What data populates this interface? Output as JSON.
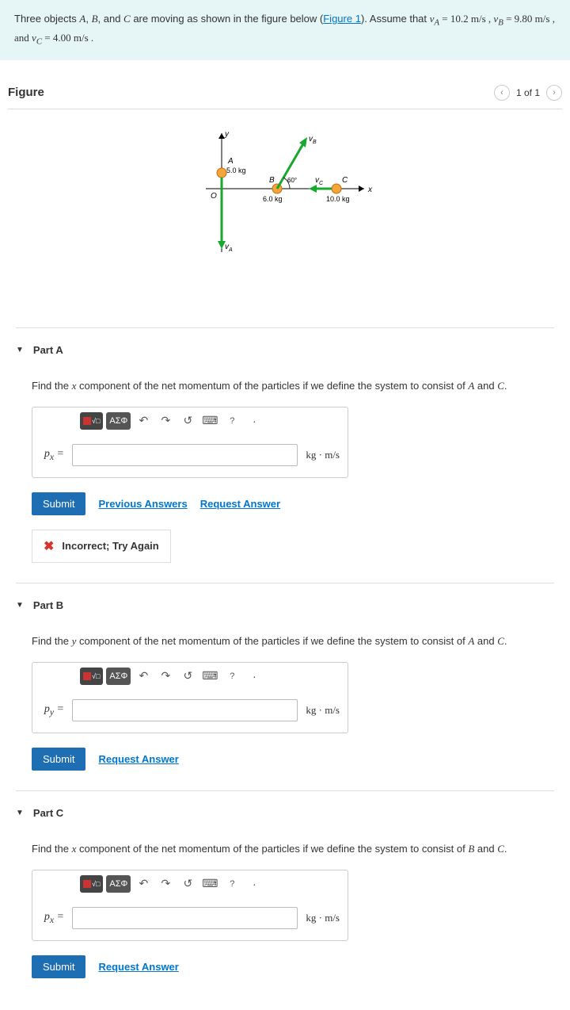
{
  "intro": {
    "pre": "Three objects ",
    "objs": "A",
    "objs_sep1": ", ",
    "objB": "B",
    "objs_sep2": ", and ",
    "objC": "C",
    "mid": " are moving as shown in the figure below (",
    "fig_link": "Figure 1",
    "post_link": "). Assume that ",
    "va_sym": "v",
    "va_sub": "A",
    "va_eq": " = 10.2 m/s , ",
    "vb_sym": "v",
    "vb_sub": "B",
    "vb_eq": " = 9.80 m/s , and ",
    "vc_sym": "v",
    "vc_sub": "C",
    "vc_eq": " = 4.00 m/s ."
  },
  "figure": {
    "title": "Figure",
    "pager_text": "1 of 1",
    "labels": {
      "O": "O",
      "x": "x",
      "y": "y",
      "A": "A",
      "B": "B",
      "C": "C",
      "mA": "5.0 kg",
      "mB": "6.0 kg",
      "mC": "10.0 kg",
      "angle": "60°",
      "vA": "v",
      "vA_sub": "A",
      "vB": "v",
      "vB_sub": "B",
      "vC": "v",
      "vC_sub": "C"
    }
  },
  "chart_data": {
    "type": "diagram",
    "axes": {
      "x": "+x right",
      "y": "+y up",
      "origin": "O"
    },
    "objects": [
      {
        "name": "A",
        "mass_kg": 5.0,
        "position": "on +y axis above origin",
        "velocity_dir": "−y (downward)",
        "speed_mps": 10.2
      },
      {
        "name": "B",
        "mass_kg": 6.0,
        "position": "on +x axis",
        "velocity_dir": "60° above +x",
        "speed_mps": 9.8
      },
      {
        "name": "C",
        "mass_kg": 10.0,
        "position": "on +x axis, right of B",
        "velocity_dir": "−x (leftward)",
        "speed_mps": 4.0
      }
    ]
  },
  "parts": [
    {
      "id": "A",
      "title": "Part A",
      "prompt_pre": "Find the ",
      "prompt_var": "x",
      "prompt_mid": " component of the net momentum of the particles if we define the system to consist of ",
      "sys1": "A",
      "sys_and": " and ",
      "sys2": "C",
      "prompt_end": ".",
      "var_label_html": "p<sub>x</sub> =",
      "unit": "kg · m/s",
      "submit": "Submit",
      "extra_links": [
        "Previous Answers",
        "Request Answer"
      ],
      "feedback": "Incorrect; Try Again"
    },
    {
      "id": "B",
      "title": "Part B",
      "prompt_pre": "Find the ",
      "prompt_var": "y",
      "prompt_mid": " component of the net momentum of the particles if we define the system to consist of ",
      "sys1": "A",
      "sys_and": " and ",
      "sys2": "C",
      "prompt_end": ".",
      "var_label_html": "p<sub>y</sub> =",
      "unit": "kg · m/s",
      "submit": "Submit",
      "extra_links": [
        "Request Answer"
      ]
    },
    {
      "id": "C",
      "title": "Part C",
      "prompt_pre": "Find the ",
      "prompt_var": "x",
      "prompt_mid": " component of the net momentum of the particles if we define the system to consist of ",
      "sys1": "B",
      "sys_and": " and ",
      "sys2": "C",
      "prompt_end": ".",
      "var_label_html": "p<sub>x</sub> =",
      "unit": "kg · m/s",
      "submit": "Submit",
      "extra_links": [
        "Request Answer"
      ]
    }
  ],
  "toolbar": {
    "greek": "ΑΣΦ"
  }
}
